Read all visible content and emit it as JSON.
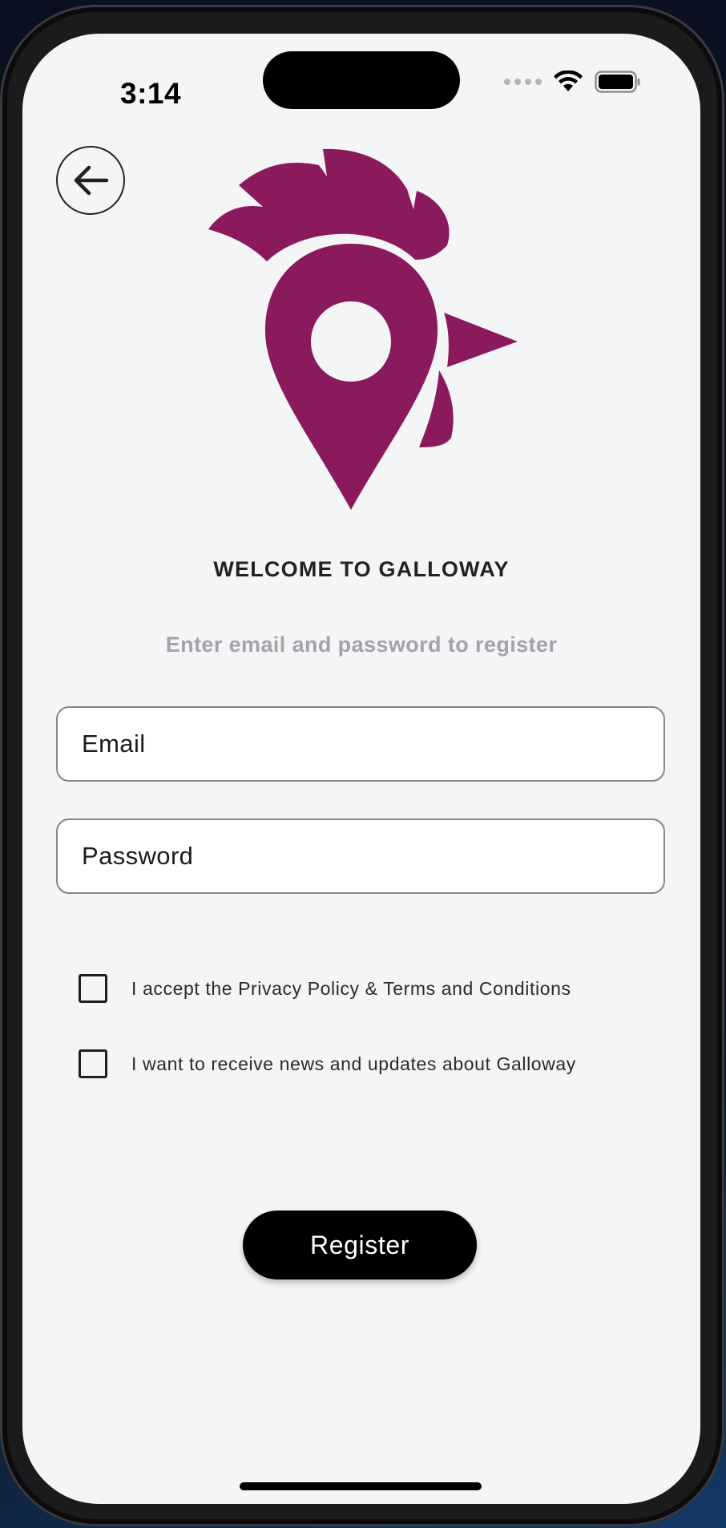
{
  "status_bar": {
    "time": "3:14"
  },
  "icons": {
    "back": "arrow-left-icon",
    "logo": "rooster-location-pin-logo",
    "wifi": "wifi-icon",
    "battery": "battery-icon",
    "signal": "cellular-signal-icon"
  },
  "brand": {
    "accent_color": "#8b1a5c"
  },
  "register": {
    "title": "WELCOME TO GALLOWAY",
    "subtitle": "Enter email and password to register",
    "email_placeholder": "Email",
    "password_placeholder": "Password",
    "accept_terms_label": "I accept the Privacy Policy & Terms and Conditions",
    "accept_terms_checked": false,
    "newsletter_label": "I want to receive news and updates about Galloway",
    "newsletter_checked": false,
    "register_button": "Register"
  }
}
